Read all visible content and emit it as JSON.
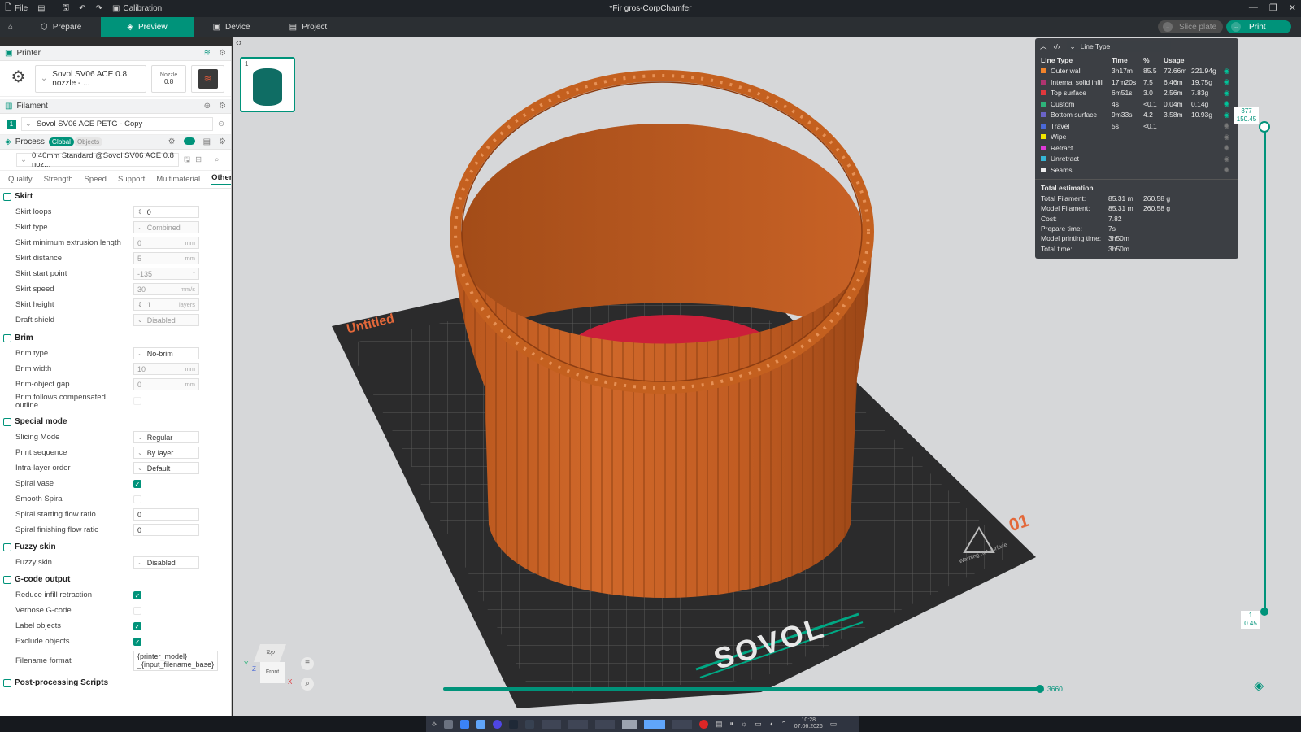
{
  "titlebar": {
    "file": "File",
    "calibration": "Calibration",
    "title": "*Fir gros-CorpChamfer"
  },
  "nav": {
    "prepare": "Prepare",
    "preview": "Preview",
    "device": "Device",
    "project": "Project",
    "slice": "Slice plate",
    "print": "Print"
  },
  "printer": {
    "header": "Printer",
    "name": "Sovol SV06 ACE 0.8 nozzle - ...",
    "nozzle_label": "Nozzle",
    "nozzle_value": "0.8"
  },
  "filament": {
    "header": "Filament",
    "index": "1",
    "name": "Sovol SV06 ACE PETG - Copy"
  },
  "process": {
    "header": "Process",
    "global": "Global",
    "objects": "Objects",
    "preset": "0.40mm Standard @Sovol SV06 ACE 0.8 noz..."
  },
  "tabs": [
    "Quality",
    "Strength",
    "Speed",
    "Support",
    "Multimaterial",
    "Others"
  ],
  "groups": {
    "skirt": {
      "title": "Skirt",
      "rows": [
        {
          "label": "Skirt loops",
          "value": "0",
          "unit": ""
        },
        {
          "label": "Skirt type",
          "value": "Combined",
          "unit": ""
        },
        {
          "label": "Skirt minimum extrusion length",
          "value": "0",
          "unit": "mm"
        },
        {
          "label": "Skirt distance",
          "value": "5",
          "unit": "mm"
        },
        {
          "label": "Skirt start point",
          "value": "-135",
          "unit": "°"
        },
        {
          "label": "Skirt speed",
          "value": "30",
          "unit": "mm/s"
        },
        {
          "label": "Skirt height",
          "value": "1",
          "unit": "layers"
        },
        {
          "label": "Draft shield",
          "value": "Disabled",
          "unit": ""
        }
      ]
    },
    "brim": {
      "title": "Brim",
      "rows": [
        {
          "label": "Brim type",
          "value": "No-brim",
          "unit": ""
        },
        {
          "label": "Brim width",
          "value": "10",
          "unit": "mm"
        },
        {
          "label": "Brim-object gap",
          "value": "0",
          "unit": "mm"
        },
        {
          "label": "Brim follows compensated",
          "label2": "outline"
        }
      ]
    },
    "special": {
      "title": "Special mode",
      "rows": [
        {
          "label": "Slicing Mode",
          "value": "Regular"
        },
        {
          "label": "Print sequence",
          "value": "By layer"
        },
        {
          "label": "Intra-layer order",
          "value": "Default"
        },
        {
          "label": "Spiral vase"
        },
        {
          "label": "Smooth Spiral"
        },
        {
          "label": "Spiral starting flow ratio",
          "value": "0"
        },
        {
          "label": "Spiral finishing flow ratio",
          "value": "0"
        }
      ]
    },
    "fuzzy": {
      "title": "Fuzzy skin",
      "rows": [
        {
          "label": "Fuzzy skin",
          "value": "Disabled"
        }
      ]
    },
    "gcode": {
      "title": "G-code output",
      "rows": [
        {
          "label": "Reduce infill retraction"
        },
        {
          "label": "Verbose G-code"
        },
        {
          "label": "Label objects"
        },
        {
          "label": "Exclude objects"
        },
        {
          "label": "Filename format",
          "value": "{printer_model}",
          "value2": "_{input_filename_base}"
        }
      ]
    },
    "post": {
      "title": "Post-processing Scripts"
    }
  },
  "viewport": {
    "plate_label": "Untitled",
    "plate_number": "01",
    "brand": "SOVOL",
    "warning": "Warning hot surface",
    "thumb_index": "1",
    "cube_top": "Top",
    "cube_front": "Front",
    "axis_x": "X",
    "axis_y": "Y",
    "axis_z": "Z"
  },
  "legend": {
    "dropdown": "Line Type",
    "headers": {
      "type": "Line Type",
      "time": "Time",
      "pct": "%",
      "usage": "Usage"
    },
    "rows": [
      {
        "name": "Outer wall",
        "color": "#f2832a",
        "time": "3h17m",
        "pct": "85.5",
        "len": "72.66m",
        "g": "221.94g"
      },
      {
        "name": "Internal solid infill",
        "color": "#b03470",
        "time": "17m20s",
        "pct": "7.5",
        "len": "6.46m",
        "g": "19.75g"
      },
      {
        "name": "Top surface",
        "color": "#e0383d",
        "time": "6m51s",
        "pct": "3.0",
        "len": "2.56m",
        "g": "7.83g"
      },
      {
        "name": "Custom",
        "color": "#2db37a",
        "time": "4s",
        "pct": "<0.1",
        "len": "0.04m",
        "g": "0.14g"
      },
      {
        "name": "Bottom surface",
        "color": "#6a63c8",
        "time": "9m33s",
        "pct": "4.2",
        "len": "3.58m",
        "g": "10.93g"
      },
      {
        "name": "Travel",
        "color": "#4a68d8",
        "time": "5s",
        "pct": "<0.1",
        "len": "",
        "g": ""
      },
      {
        "name": "Wipe",
        "color": "#f0e400",
        "time": "",
        "pct": "",
        "len": "",
        "g": ""
      },
      {
        "name": "Retract",
        "color": "#e03ad8",
        "time": "",
        "pct": "",
        "len": "",
        "g": ""
      },
      {
        "name": "Unretract",
        "color": "#36b5d6",
        "time": "",
        "pct": "",
        "len": "",
        "g": ""
      },
      {
        "name": "Seams",
        "color": "#eeeeee",
        "time": "",
        "pct": "",
        "len": "",
        "g": ""
      }
    ],
    "estimation": "Total estimation",
    "est": [
      {
        "k": "Total Filament:",
        "v1": "85.31 m",
        "v2": "260.58 g"
      },
      {
        "k": "Model Filament:",
        "v1": "85.31 m",
        "v2": "260.58 g"
      },
      {
        "k": "Cost:",
        "v1": "7.82",
        "v2": ""
      },
      {
        "k": "Prepare time:",
        "v1": "7s",
        "v2": ""
      },
      {
        "k": "Model printing time:",
        "v1": "3h50m",
        "v2": ""
      },
      {
        "k": "Total time:",
        "v1": "3h50m",
        "v2": ""
      }
    ]
  },
  "slider": {
    "top_layer": "377",
    "top_height": "150.45",
    "bottom_layer": "1",
    "bottom_height": "0.45",
    "moves": "3660"
  },
  "taskbar": {
    "time": "10:28",
    "date": "07.06.2026"
  }
}
